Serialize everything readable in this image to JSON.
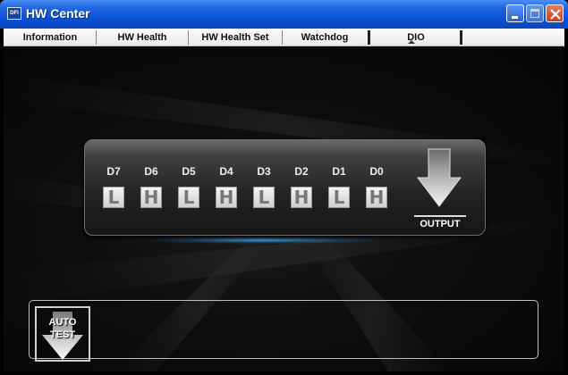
{
  "window": {
    "title": "HW Center",
    "app_icon_text": "DFI",
    "controls": [
      "minimize",
      "maximize",
      "close"
    ]
  },
  "tabs": [
    {
      "label": "Information"
    },
    {
      "label": "HW Health"
    },
    {
      "label": "HW Health Set"
    },
    {
      "label": "Watchdog"
    },
    {
      "label": "DIO"
    }
  ],
  "active_tab": "DIO",
  "dio": {
    "bits": [
      {
        "label": "D7",
        "state": "L"
      },
      {
        "label": "D6",
        "state": "H"
      },
      {
        "label": "D5",
        "state": "L"
      },
      {
        "label": "D4",
        "state": "H"
      },
      {
        "label": "D3",
        "state": "L"
      },
      {
        "label": "D2",
        "state": "H"
      },
      {
        "label": "D1",
        "state": "L"
      },
      {
        "label": "D0",
        "state": "H"
      }
    ],
    "output_label": "OUTPUT"
  },
  "auto_test": {
    "line1": "AUTO",
    "line2": "TEST"
  },
  "colors": {
    "titlebar": "#0a4fd4",
    "background": "#0d0d0d",
    "accent_glow": "#3caae6"
  }
}
